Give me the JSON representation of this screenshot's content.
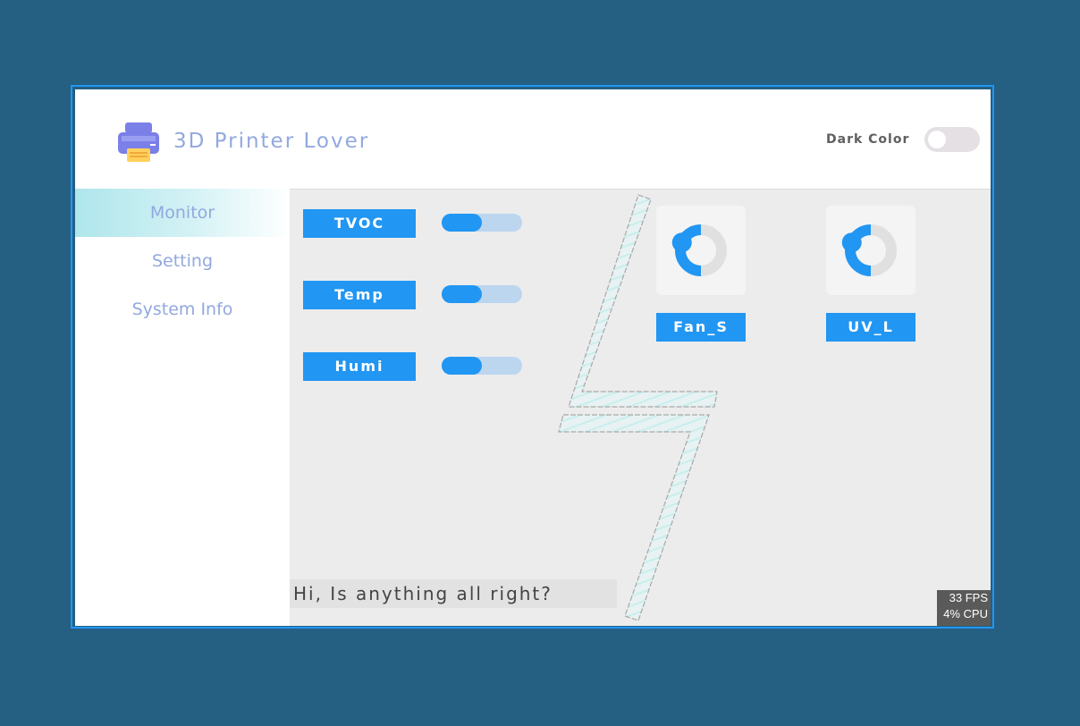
{
  "app": {
    "title": "3D Printer Lover",
    "logo_icon": "printer-icon"
  },
  "header": {
    "dark_color_label": "Dark Color",
    "dark_color_enabled": false
  },
  "sidebar": {
    "items": [
      {
        "label": "Monitor",
        "active": true
      },
      {
        "label": "Setting",
        "active": false
      },
      {
        "label": "System Info",
        "active": false
      }
    ]
  },
  "sensors": [
    {
      "label": "TVOC",
      "level": 0.5
    },
    {
      "label": "Temp",
      "level": 0.5
    },
    {
      "label": "Humi",
      "level": 0.5
    }
  ],
  "devices": [
    {
      "label": "Fan_S",
      "arc_level": 0.5
    },
    {
      "label": "UV_L",
      "arc_level": 0.5
    }
  ],
  "message": "Hi, Is anything all right?",
  "perf": {
    "fps": "33 FPS",
    "cpu": "4% CPU"
  },
  "colors": {
    "accent": "#2196f3",
    "title_text": "#92a8df",
    "background": "#255f82"
  }
}
